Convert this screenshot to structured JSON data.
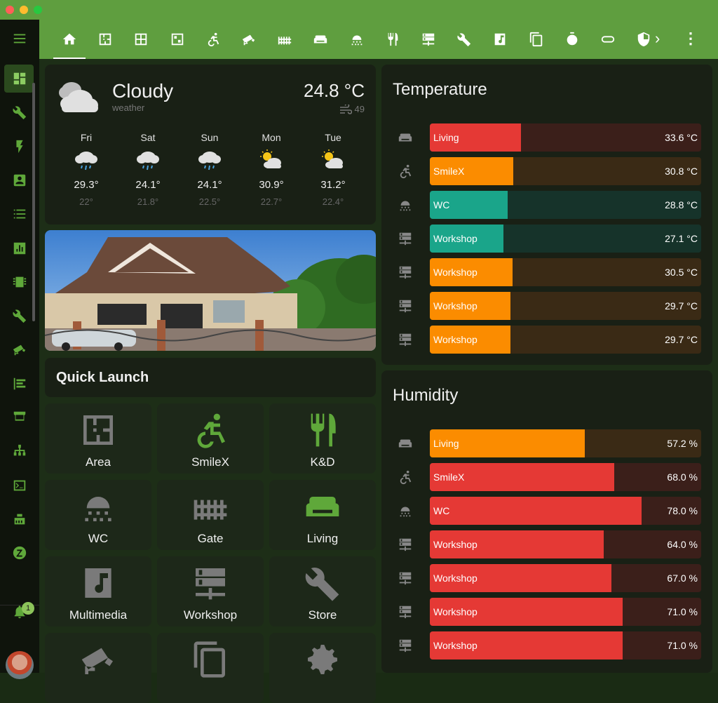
{
  "topbar": {
    "tabs": [
      "home-icon",
      "floor-plan-icon",
      "area-icon",
      "area-alt-icon",
      "accessible-icon",
      "cctv-icon",
      "gate-icon",
      "sofa-icon",
      "shower-icon",
      "silverware-icon",
      "server-icon",
      "wrench-icon",
      "music-icon",
      "copy-icon",
      "timer-icon",
      "toggle-icon",
      "shield-icon"
    ],
    "more_arrow": "›",
    "menu_glyph": "⋮"
  },
  "sidebar": {
    "items": [
      "dashboard-icon",
      "wrench-icon",
      "bolt-icon",
      "account-box-icon",
      "list-icon",
      "chart-icon",
      "chip-icon",
      "wrench-alt-icon",
      "cctv-icon",
      "logbook-icon",
      "hacs-icon",
      "sitemap-icon",
      "terminal-icon",
      "router-icon",
      "zwave-icon"
    ],
    "notification_count": "1"
  },
  "weather": {
    "condition": "Cloudy",
    "subtitle": "weather",
    "temperature": "24.8 °C",
    "wind": "49",
    "forecast": [
      {
        "day": "Fri",
        "hi": "29.3°",
        "lo": "22°",
        "icon": "rain"
      },
      {
        "day": "Sat",
        "hi": "24.1°",
        "lo": "21.8°",
        "icon": "rain"
      },
      {
        "day": "Sun",
        "hi": "24.1°",
        "lo": "22.5°",
        "icon": "rain"
      },
      {
        "day": "Mon",
        "hi": "30.9°",
        "lo": "22.7°",
        "icon": "partly-cloudy"
      },
      {
        "day": "Tue",
        "hi": "31.2°",
        "lo": "22.4°",
        "icon": "partly-cloudy"
      }
    ]
  },
  "quick_launch": {
    "title": "Quick Launch",
    "tiles": [
      {
        "label": "Area",
        "icon": "floor-plan-icon",
        "color": "#7a7a7a"
      },
      {
        "label": "SmileX",
        "icon": "accessible-icon",
        "color": "#5fa83a"
      },
      {
        "label": "K&D",
        "icon": "silverware-icon",
        "color": "#5fa83a"
      },
      {
        "label": "WC",
        "icon": "shower-icon",
        "color": "#7a7a7a"
      },
      {
        "label": "Gate",
        "icon": "gate-icon",
        "color": "#7a7a7a"
      },
      {
        "label": "Living",
        "icon": "sofa-icon",
        "color": "#5fa83a"
      },
      {
        "label": "Multimedia",
        "icon": "music-icon",
        "color": "#7a7a7a"
      },
      {
        "label": "Workshop",
        "icon": "server-icon",
        "color": "#7a7a7a"
      },
      {
        "label": "Store",
        "icon": "wrench-icon",
        "color": "#7a7a7a"
      },
      {
        "label": "",
        "icon": "cctv-icon",
        "color": "#7a7a7a"
      },
      {
        "label": "",
        "icon": "copy-icon",
        "color": "#7a7a7a"
      },
      {
        "label": "",
        "icon": "cog-icon",
        "color": "#7a7a7a"
      }
    ]
  },
  "temperature": {
    "title": "Temperature",
    "bars": [
      {
        "name": "Living",
        "value": "33.6 °C",
        "level": 0.336,
        "icon": "sofa-icon",
        "color": "#e53935",
        "track": "#3b1f1a"
      },
      {
        "name": "SmileX",
        "value": "30.8 °C",
        "level": 0.308,
        "icon": "accessible-icon",
        "color": "#fb8c00",
        "track": "#3a2a15"
      },
      {
        "name": "WC",
        "value": "28.8 °C",
        "level": 0.288,
        "icon": "shower-icon",
        "color": "#1aa58a",
        "track": "#16332a"
      },
      {
        "name": "Workshop",
        "value": "27.1 °C",
        "level": 0.271,
        "icon": "server-icon",
        "color": "#1aa58a",
        "track": "#16332a"
      },
      {
        "name": "Workshop",
        "value": "30.5 °C",
        "level": 0.305,
        "icon": "server-icon",
        "color": "#fb8c00",
        "track": "#3a2a15"
      },
      {
        "name": "Workshop",
        "value": "29.7 °C",
        "level": 0.297,
        "icon": "server-icon",
        "color": "#fb8c00",
        "track": "#3a2a15"
      },
      {
        "name": "Workshop",
        "value": "29.7 °C",
        "level": 0.297,
        "icon": "server-icon",
        "color": "#fb8c00",
        "track": "#3a2a15"
      }
    ]
  },
  "humidity": {
    "title": "Humidity",
    "bars": [
      {
        "name": "Living",
        "value": "57.2 %",
        "level": 0.572,
        "icon": "sofa-icon",
        "color": "#fb8c00",
        "track": "#3a2a15"
      },
      {
        "name": "SmileX",
        "value": "68.0 %",
        "level": 0.68,
        "icon": "accessible-icon",
        "color": "#e53935",
        "track": "#3b1f1a"
      },
      {
        "name": "WC",
        "value": "78.0 %",
        "level": 0.78,
        "icon": "shower-icon",
        "color": "#e53935",
        "track": "#3b1f1a"
      },
      {
        "name": "Workshop",
        "value": "64.0 %",
        "level": 0.64,
        "icon": "server-icon",
        "color": "#e53935",
        "track": "#3b1f1a"
      },
      {
        "name": "Workshop",
        "value": "67.0 %",
        "level": 0.67,
        "icon": "server-icon",
        "color": "#e53935",
        "track": "#3b1f1a"
      },
      {
        "name": "Workshop",
        "value": "71.0 %",
        "level": 0.71,
        "icon": "server-icon",
        "color": "#e53935",
        "track": "#3b1f1a"
      },
      {
        "name": "Workshop",
        "value": "71.0 %",
        "level": 0.71,
        "icon": "server-icon",
        "color": "#e53935",
        "track": "#3b1f1a"
      }
    ]
  }
}
